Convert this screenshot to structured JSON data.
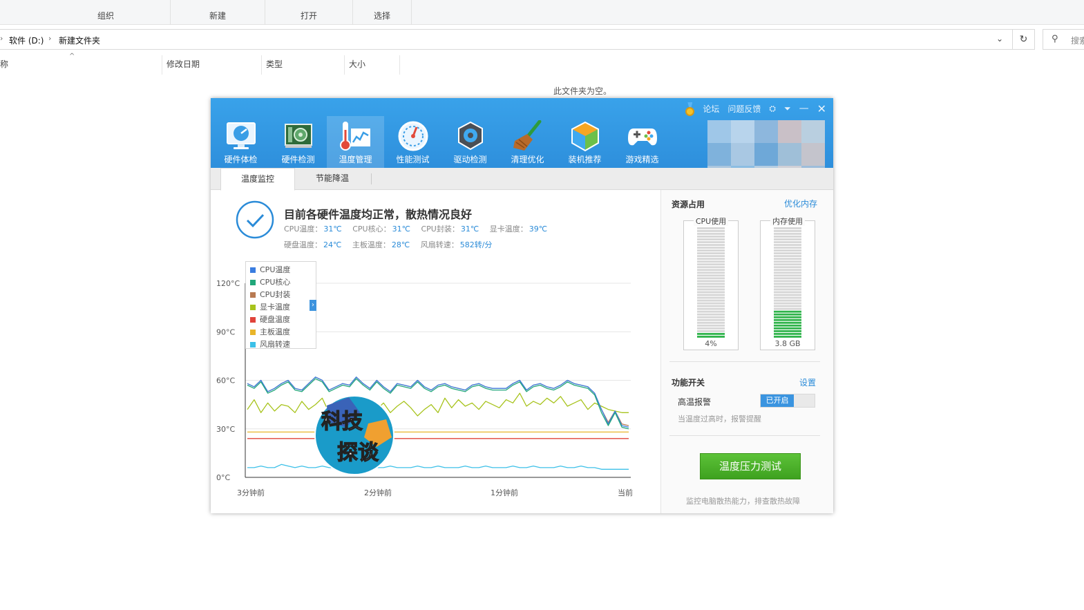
{
  "explorer": {
    "ribbon_groups": [
      "组织",
      "新建",
      "打开",
      "选择"
    ],
    "breadcrumb": [
      "软件 (D:)",
      "新建文件夹"
    ],
    "search_placeholder": "搜索",
    "columns": [
      "称",
      "修改日期",
      "类型",
      "大小"
    ],
    "empty_message": "此文件夹为空。"
  },
  "app": {
    "title_links": {
      "forum": "论坛",
      "feedback": "问题反馈"
    },
    "nav": [
      {
        "label": "硬件体检",
        "icon": "monitor-gauge-icon"
      },
      {
        "label": "硬件检测",
        "icon": "circuit-board-icon"
      },
      {
        "label": "温度管理",
        "icon": "thermometer-chart-icon",
        "active": true
      },
      {
        "label": "性能测试",
        "icon": "speedometer-icon"
      },
      {
        "label": "驱动检测",
        "icon": "gear-chip-icon"
      },
      {
        "label": "清理优化",
        "icon": "broom-icon"
      },
      {
        "label": "装机推荐",
        "icon": "cube-icon"
      },
      {
        "label": "游戏精选",
        "icon": "gamepad-icon"
      }
    ],
    "subtabs": [
      "温度监控",
      "节能降温"
    ],
    "status": {
      "title": "目前各硬件温度均正常，散热情况良好",
      "row1": [
        {
          "k": "CPU温度：",
          "v": "31℃"
        },
        {
          "k": "CPU核心：",
          "v": "31℃"
        },
        {
          "k": "CPU封装：",
          "v": "31℃"
        },
        {
          "k": "显卡温度：",
          "v": "39℃"
        }
      ],
      "row2": [
        {
          "k": "硬盘温度：",
          "v": "24℃"
        },
        {
          "k": "主板温度：",
          "v": "28℃"
        },
        {
          "k": "风扇转速：",
          "v": "582转/分"
        }
      ]
    },
    "resources": {
      "title": "资源占用",
      "link": "优化内存",
      "cpu": {
        "label": "CPU使用",
        "value": "4%",
        "fraction": 0.04
      },
      "mem": {
        "label": "内存使用",
        "value": "3.8 GB",
        "fraction": 0.24
      },
      "colors": {
        "empty": "#d6d6d6",
        "filled": "#2fb34a"
      }
    },
    "functions": {
      "title": "功能开关",
      "link": "设置",
      "alarm_label": "高温报警",
      "alarm_state": "已开启",
      "alarm_desc": "当温度过高时，报警提醒"
    },
    "stress": {
      "button": "温度压力测试",
      "desc": "监控电脑散热能力，排查散热故障"
    },
    "watermark": [
      "科技",
      "探谈"
    ]
  },
  "chart_data": {
    "type": "line",
    "x_tick_labels": [
      "3分钟前",
      "2分钟前",
      "1分钟前",
      "当前"
    ],
    "y_tick_labels": [
      "0°C",
      "30°C",
      "60°C",
      "90°C",
      "120°C"
    ],
    "ylim": [
      0,
      120
    ],
    "grid": true,
    "legend_placement": "top-left",
    "series": [
      {
        "name": "CPU温度",
        "color": "#3a7de0",
        "values": [
          58,
          56,
          60,
          53,
          55,
          58,
          60,
          55,
          54,
          58,
          62,
          60,
          54,
          56,
          58,
          57,
          62,
          58,
          55,
          60,
          56,
          53,
          58,
          57,
          56,
          60,
          56,
          54,
          57,
          58,
          56,
          55,
          54,
          57,
          58,
          56,
          55,
          55,
          55,
          58,
          60,
          54,
          57,
          58,
          56,
          55,
          57,
          60,
          58,
          57,
          56,
          52,
          42,
          33,
          41,
          32,
          31
        ]
      },
      {
        "name": "CPU核心",
        "color": "#21a77a",
        "values": [
          57,
          55,
          59,
          52,
          54,
          57,
          59,
          54,
          53,
          57,
          61,
          59,
          53,
          55,
          57,
          56,
          61,
          57,
          54,
          59,
          55,
          52,
          57,
          56,
          55,
          59,
          55,
          53,
          56,
          57,
          55,
          54,
          53,
          56,
          57,
          55,
          54,
          54,
          54,
          57,
          59,
          53,
          56,
          57,
          55,
          54,
          56,
          59,
          57,
          56,
          55,
          51,
          40,
          32,
          40,
          31,
          30
        ]
      },
      {
        "name": "CPU封装",
        "color": "#b87a52",
        "values": [
          58,
          56,
          60,
          53,
          55,
          58,
          60,
          55,
          54,
          58,
          62,
          60,
          54,
          56,
          58,
          57,
          62,
          58,
          55,
          60,
          56,
          53,
          58,
          57,
          56,
          60,
          56,
          54,
          57,
          58,
          56,
          55,
          54,
          57,
          58,
          56,
          55,
          55,
          55,
          58,
          60,
          54,
          57,
          58,
          56,
          55,
          57,
          60,
          58,
          57,
          56,
          52,
          42,
          34,
          41,
          33,
          32
        ]
      },
      {
        "name": "显卡温度",
        "color": "#a7c31c",
        "values": [
          42,
          48,
          40,
          46,
          41,
          45,
          44,
          40,
          47,
          42,
          45,
          49,
          40,
          43,
          46,
          41,
          39,
          44,
          48,
          42,
          46,
          40,
          44,
          47,
          43,
          38,
          42,
          45,
          40,
          49,
          43,
          48,
          44,
          46,
          42,
          47,
          45,
          43,
          48,
          46,
          52,
          44,
          47,
          45,
          49,
          46,
          50,
          44,
          46,
          48,
          42,
          46,
          44,
          42,
          41,
          40,
          40
        ]
      },
      {
        "name": "硬盘温度",
        "color": "#e0433a",
        "values": [
          24,
          24,
          24,
          24,
          24,
          24,
          24,
          24,
          24,
          24,
          24,
          24,
          24,
          24,
          24,
          24,
          24,
          24,
          24,
          24,
          24,
          24,
          24,
          24,
          24,
          24,
          24,
          24,
          24,
          24,
          24,
          24,
          24,
          24,
          24,
          24,
          24,
          24,
          24,
          24,
          24,
          24,
          24,
          24,
          24,
          24,
          24,
          24,
          24,
          24,
          24,
          24,
          24,
          24,
          24,
          24,
          24
        ]
      },
      {
        "name": "主板温度",
        "color": "#e9b52a",
        "values": [
          28,
          28,
          28,
          28,
          28,
          28,
          28,
          28,
          28,
          28,
          28,
          28,
          28,
          28,
          28,
          28,
          28,
          28,
          28,
          28,
          28,
          28,
          28,
          28,
          28,
          28,
          28,
          28,
          28,
          28,
          28,
          28,
          28,
          28,
          28,
          28,
          28,
          28,
          28,
          28,
          28,
          28,
          28,
          28,
          28,
          28,
          28,
          28,
          28,
          28,
          28,
          28,
          28,
          28,
          28,
          28,
          28
        ]
      },
      {
        "name": "风扇转速",
        "color": "#3cc0e8",
        "values": [
          6,
          6,
          7,
          6,
          6,
          8,
          7,
          6,
          7,
          6,
          6,
          7,
          6,
          6,
          7,
          6,
          6,
          6,
          7,
          6,
          6,
          7,
          6,
          6,
          6,
          7,
          6,
          6,
          7,
          6,
          6,
          6,
          7,
          6,
          6,
          7,
          6,
          6,
          6,
          7,
          6,
          6,
          7,
          6,
          6,
          6,
          7,
          6,
          6,
          7,
          6,
          6,
          5,
          5,
          5,
          5,
          5
        ]
      }
    ]
  }
}
